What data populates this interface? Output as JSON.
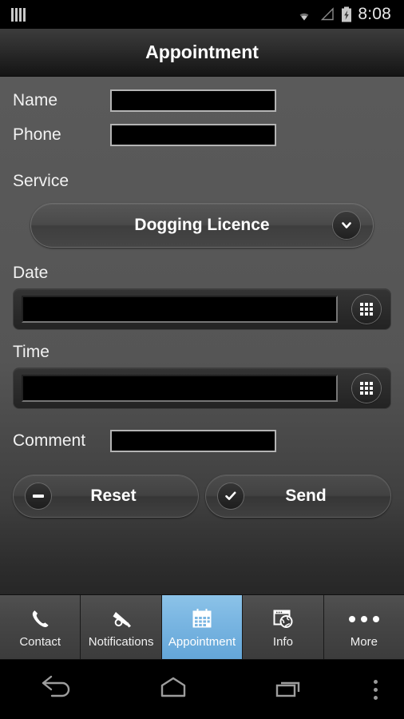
{
  "statusbar": {
    "notification_icon": "barcode-bars-icon",
    "wifi_icon": "wifi-icon",
    "signal_icon": "cell-signal-icon",
    "battery_icon": "battery-charging-icon",
    "time": "8:08"
  },
  "titlebar": {
    "title": "Appointment"
  },
  "form": {
    "name": {
      "label": "Name",
      "value": "",
      "placeholder": ""
    },
    "phone": {
      "label": "Phone",
      "value": "",
      "placeholder": ""
    },
    "service": {
      "label": "Service",
      "selected": "Dogging Licence",
      "dropdown_icon": "chevron-down-icon"
    },
    "date": {
      "label": "Date",
      "value": "",
      "picker_icon": "keypad-grid-icon"
    },
    "time": {
      "label": "Time",
      "value": "",
      "picker_icon": "keypad-grid-icon"
    },
    "comment": {
      "label": "Comment",
      "value": "",
      "placeholder": ""
    },
    "reset_button": {
      "label": "Reset",
      "icon": "minus-circle-icon"
    },
    "send_button": {
      "label": "Send",
      "icon": "check-circle-icon"
    }
  },
  "tabbar": {
    "active_index": 2,
    "active_color": "#7ab6e2",
    "items": [
      {
        "label": "Contact",
        "icon": "phone-icon"
      },
      {
        "label": "Notifications",
        "icon": "megaphone-icon"
      },
      {
        "label": "Appointment",
        "icon": "calendar-icon"
      },
      {
        "label": "Info",
        "icon": "browser-globe-icon"
      },
      {
        "label": "More",
        "icon": "ellipsis-horizontal-icon"
      }
    ]
  },
  "navbar": {
    "back": "back-arrow-icon",
    "home": "home-icon",
    "recents": "recents-icon",
    "menu": "overflow-menu-icon"
  }
}
